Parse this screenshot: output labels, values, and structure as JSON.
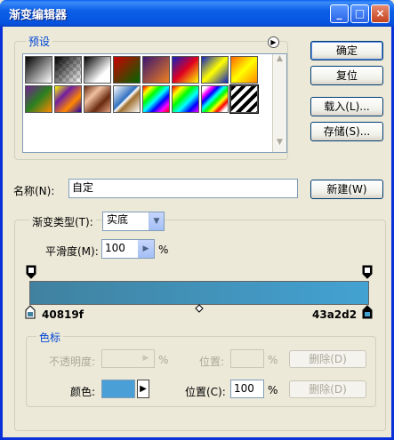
{
  "window": {
    "title": "渐变编辑器",
    "minimize": "_",
    "maximize": "□",
    "close": "×"
  },
  "buttons": {
    "ok": "确定",
    "reset": "复位",
    "load": "载入(L)...",
    "save": "存储(S)...",
    "new": "新建(W)"
  },
  "presets": {
    "legend": "预设",
    "swatches": [
      "black-white",
      "transparent-checker",
      "black-white-2",
      "red-green",
      "violet-orange",
      "blue-red-yellow",
      "blue-yellow-blue",
      "orange-yellow-orange",
      "violet-green-orange",
      "yellow-violet-orange-blue",
      "copper",
      "chrome",
      "spectrum",
      "rainbow-transparent",
      "rainbow-2",
      "stripes"
    ]
  },
  "name": {
    "label": "名称(N):",
    "value": "自定"
  },
  "gradient": {
    "type_label": "渐变类型(T):",
    "type_value": "实底",
    "smooth_label": "平滑度(M):",
    "smooth_value": "100",
    "smooth_unit": "%",
    "start_color_label": "40819f",
    "end_color_label": "43a2d2",
    "colors": {
      "start": "#40819f",
      "end": "#43a2d2"
    }
  },
  "stops": {
    "legend": "色标",
    "opacity_label": "不透明度:",
    "opacity_unit": "%",
    "opacity_location_label": "位置:",
    "opacity_location_unit": "%",
    "delete_opacity": "删除(D)",
    "color_label": "颜色:",
    "color_value": "#4aa0d6",
    "location_label": "位置(C):",
    "location_value": "100",
    "location_unit": "%",
    "delete_color": "删除(D)"
  }
}
